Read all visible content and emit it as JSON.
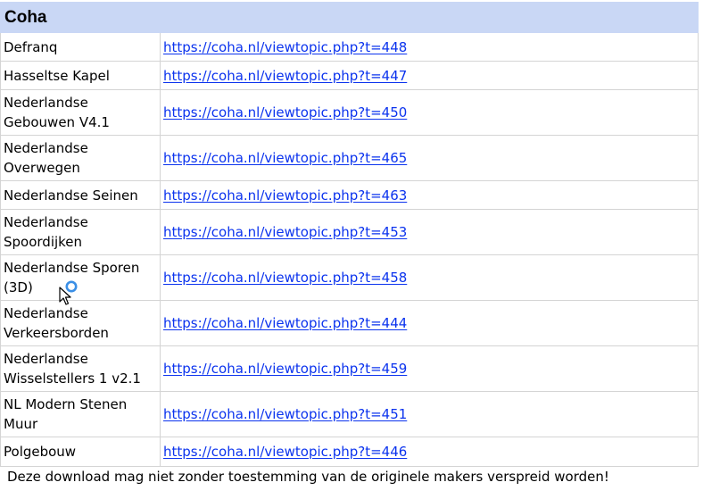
{
  "sheet": {
    "title": "Coha",
    "rows": [
      {
        "name": "Defranq",
        "url": "https://coha.nl/viewtopic.php?t=448"
      },
      {
        "name": "Hasseltse Kapel",
        "url": "https://coha.nl/viewtopic.php?t=447"
      },
      {
        "name_line1": "Nederlandse",
        "name_line2": "Gebouwen V4.1",
        "url": "https://coha.nl/viewtopic.php?t=450"
      },
      {
        "name_line1": "Nederlandse",
        "name_line2": "Overwegen",
        "url": "https://coha.nl/viewtopic.php?t=465"
      },
      {
        "name": "Nederlandse Seinen",
        "url": "https://coha.nl/viewtopic.php?t=463"
      },
      {
        "name_line1": "Nederlandse",
        "name_line2": "Spoordijken",
        "url": "https://coha.nl/viewtopic.php?t=453"
      },
      {
        "name_line1": "Nederlandse Sporen",
        "name_line2": "(3D)",
        "url": "https://coha.nl/viewtopic.php?t=458"
      },
      {
        "name_line1": "Nederlandse",
        "name_line2": "Verkeersborden",
        "url": "https://coha.nl/viewtopic.php?t=444"
      },
      {
        "name_line1": "Nederlandse",
        "name_line2": "Wisselstellers 1 v2.1",
        "url": "https://coha.nl/viewtopic.php?t=459"
      },
      {
        "name_line1": "NL Modern Stenen",
        "name_line2": "Muur",
        "url": "https://coha.nl/viewtopic.php?t=451"
      },
      {
        "name": "Polgebouw",
        "url": "https://coha.nl/viewtopic.php?t=446"
      }
    ]
  },
  "footer": {
    "notice": "Deze download mag niet zonder toestemming van de originele makers verspreid worden!"
  },
  "colors": {
    "header_bg": "#c9d7f5",
    "link": "#0b33ee",
    "grid": "#d4d4d4",
    "cursor_ring": "#3b8fe6"
  },
  "icons": {
    "cursor": "pointer-busy-cursor-icon"
  }
}
